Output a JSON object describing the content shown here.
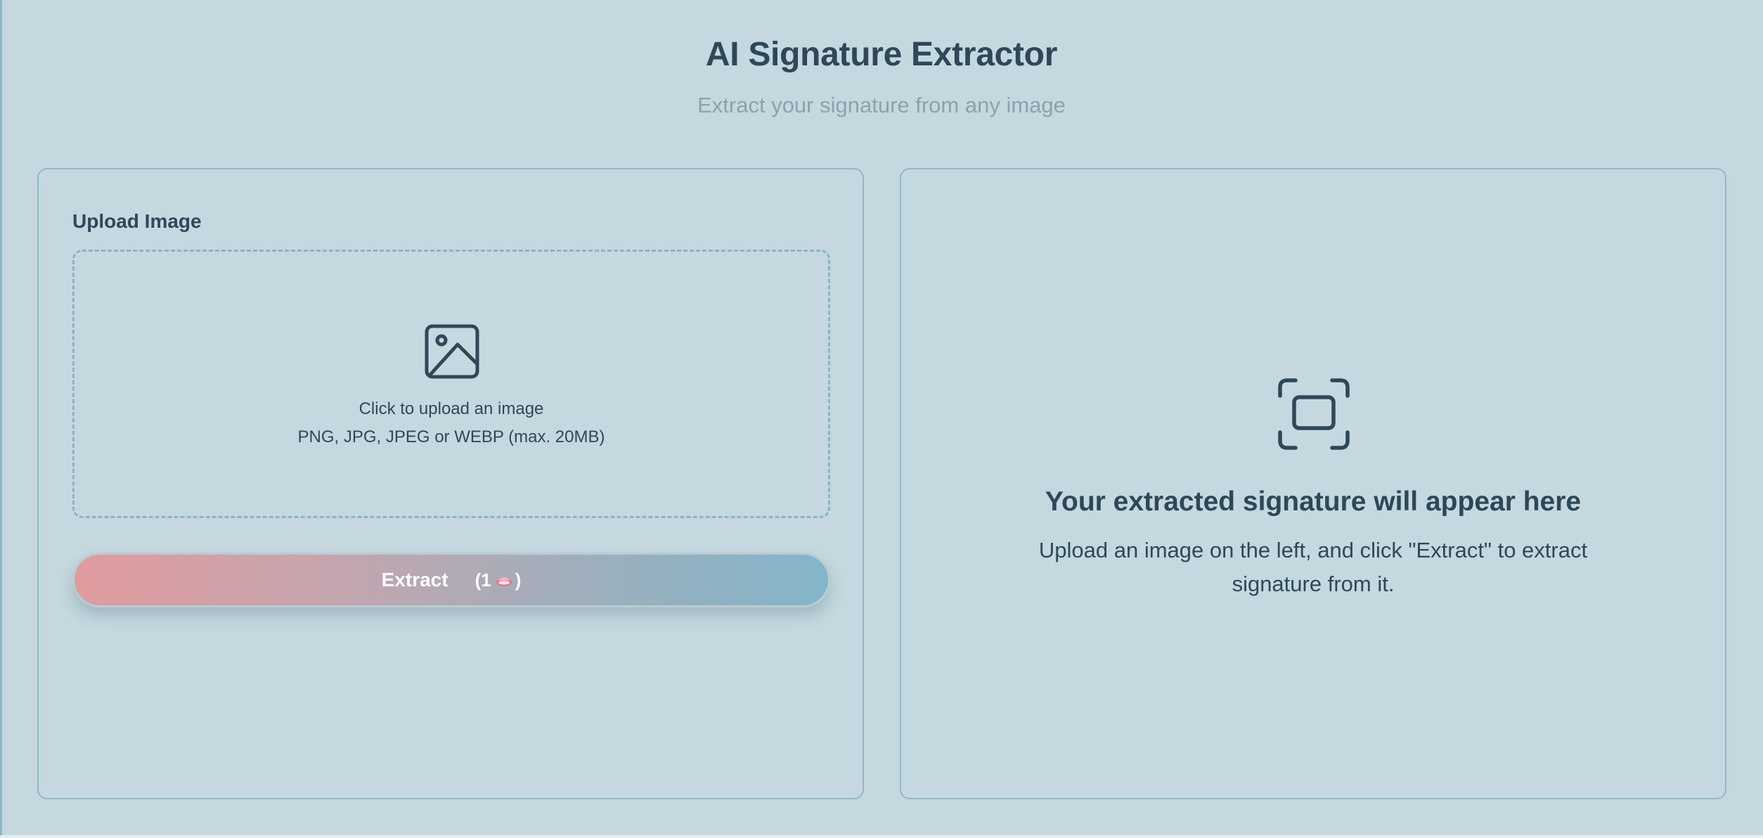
{
  "header": {
    "title": "AI Signature Extractor",
    "subtitle": "Extract your signature from any image"
  },
  "upload": {
    "label": "Upload Image",
    "dropzone_main": "Click to upload an image",
    "dropzone_formats": "PNG, JPG, JPEG or WEBP (max. 20MB)",
    "icon": "image-icon"
  },
  "extract_button": {
    "label": "Extract",
    "credit_open": "(1",
    "credit_close": ")",
    "credit_icon": "credit-gem-icon"
  },
  "result": {
    "icon": "frame-corners-icon",
    "title": "Your extracted signature will appear here",
    "description": "Upload an image on the left, and click \"Extract\" to extract signature from it."
  },
  "colors": {
    "background": "#c5d8df",
    "text": "#2e4858",
    "muted": "#8ea2ab",
    "border": "#8fb9ca",
    "gradient_start": "#e09b9d",
    "gradient_end": "#82b6c9"
  }
}
